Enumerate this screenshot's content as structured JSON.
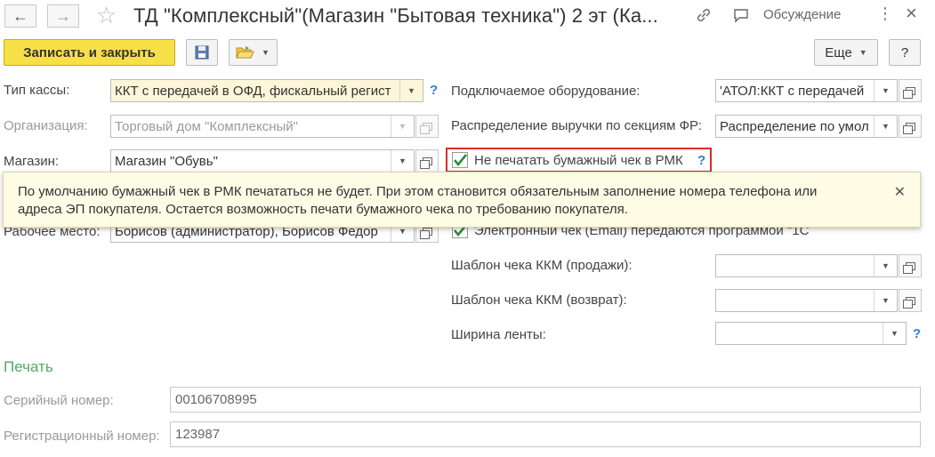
{
  "window": {
    "title": "ТД \"Комплексный\"(Магазин \"Бытовая техника\") 2 эт (Ка...",
    "discussion_label": "Обсуждение",
    "menu_glyph": "⋮",
    "close_glyph": "×"
  },
  "toolbar": {
    "save_close_label": "Записать и закрыть",
    "more_label": "Еще",
    "help_label": "?"
  },
  "form": {
    "cash_type": {
      "label": "Тип кассы:",
      "value": "ККТ с передачей в ОФД, фискальный регист"
    },
    "organization": {
      "label": "Организация:",
      "value": "Торговый дом \"Комплексный\""
    },
    "store": {
      "label": "Магазин:",
      "value": "Магазин \"Обувь\""
    },
    "workplace": {
      "label": "Рабочее место:",
      "value": "Борисов (администратор), Борисов Федор"
    },
    "equipment": {
      "label": "Подключаемое оборудование:",
      "value": "'АТОЛ:ККТ с передачей"
    },
    "revenue_distribution": {
      "label": "Распределение выручки по секциям ФР:",
      "value": "Распределение по умол"
    },
    "no_paper_receipt": {
      "label": "Не печатать бумажный чек в РМК",
      "checked": true
    },
    "email_receipt": {
      "label": "Электронный чек (Email) передаются программой \"1С",
      "checked": true
    },
    "receipt_template_sale": {
      "label": "Шаблон чека ККМ (продажи):",
      "value": ""
    },
    "receipt_template_return": {
      "label": "Шаблон чека ККМ (возврат):",
      "value": ""
    },
    "tape_width": {
      "label": "Ширина ленты:",
      "value": ""
    }
  },
  "tooltip": {
    "text": "По умолчанию бумажный чек в РМК печататься не будет. При этом становится обязательным заполнение номера телефона или адреса ЭП покупателя. Остается возможность печати бумажного чека по требованию покупателя."
  },
  "print_section": {
    "title": "Печать",
    "serial_number": {
      "label": "Серийный номер:",
      "value": "00106708995"
    },
    "registration_number": {
      "label": "Регистрационный номер:",
      "value": "123987"
    }
  },
  "colors": {
    "primary_button": "#f7e047",
    "section_title": "#4fae62",
    "help": "#3a7bc8",
    "highlight": "#d92c2c",
    "tooltip_bg": "#fffce6"
  }
}
